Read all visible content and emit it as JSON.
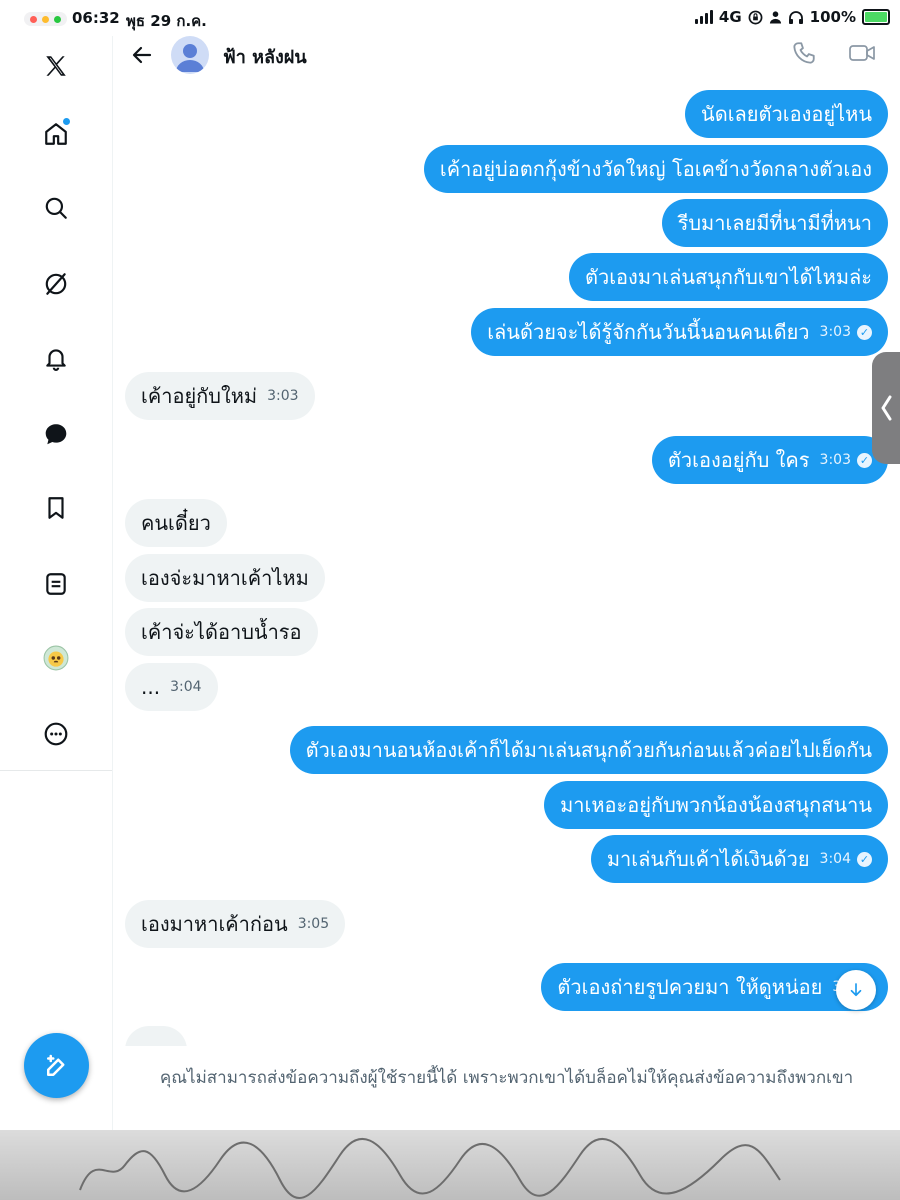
{
  "status_bar": {
    "time": "06:32",
    "date": "พุธ 29 ก.ค.",
    "network": "4G",
    "battery": "100%"
  },
  "header": {
    "contact_name": "ฟ้า หลังฝน"
  },
  "messages": [
    {
      "dir": "out",
      "text": "นัดเลยตัวเองอยู่ไหน",
      "time": "",
      "read": false
    },
    {
      "dir": "out",
      "text": "เค้าอยู่บ่อตกกุ้งข้างวัดใหญ่ โอเคข้างวัดกลางตัวเอง",
      "time": "",
      "read": false
    },
    {
      "dir": "out",
      "text": "รีบมาเลยมีที่นามีที่หนา",
      "time": "",
      "read": false
    },
    {
      "dir": "out",
      "text": "ตัวเองมาเล่นสนุกกับเขาได้ไหมล่ะ",
      "time": "",
      "read": false
    },
    {
      "dir": "out",
      "text": "เล่นด้วยจะได้รู้จักกันวันนี้นอนคนเดียว",
      "time": "3:03",
      "read": true
    },
    {
      "dir": "in",
      "text": "เค้าอยู่กับใหม่",
      "time": "3:03"
    },
    {
      "dir": "out",
      "text": "ตัวเองอยู่กับ ใคร",
      "time": "3:03",
      "read": true
    },
    {
      "dir": "in",
      "text": "คนเดี๋ยว",
      "time": ""
    },
    {
      "dir": "in",
      "text": "เองจ่ะมาหาเค้าไหม",
      "time": ""
    },
    {
      "dir": "in",
      "text": "เค้าจ่ะได้อาบน้ำรอ",
      "time": ""
    },
    {
      "dir": "in",
      "text": "...",
      "time": "3:04"
    },
    {
      "dir": "out",
      "text": "ตัวเองมานอนห้องเค้าก็ได้มาเล่นสนุกด้วยกันก่อนแล้วค่อยไปเย็ดกัน",
      "time": "",
      "read": false
    },
    {
      "dir": "out",
      "text": "มาเหอะอยู่กับพวกน้องน้องสนุกสนาน",
      "time": "",
      "read": false
    },
    {
      "dir": "out",
      "text": "มาเล่นกับเค้าได้เงินด้วย",
      "time": "3:04",
      "read": true
    },
    {
      "dir": "in",
      "text": "เองมาหาเค้าก่อน",
      "time": "3:05"
    },
    {
      "dir": "out",
      "text": "ตัวเองถ่ายรูปควยมา ให้ดูหน่อย",
      "time": "3:",
      "read": false
    }
  ],
  "blocked_notice": "คุณไม่สามารถส่งข้อความถึงผู้ใช้รายนี้ได้ เพราะพวกเขาได้บล็อคไม่ให้คุณส่งข้อความถึงพวกเขา",
  "colors": {
    "accent": "#1d9bf0",
    "incoming_bubble": "#eff3f4",
    "text": "#0f1419",
    "muted": "#536471"
  }
}
